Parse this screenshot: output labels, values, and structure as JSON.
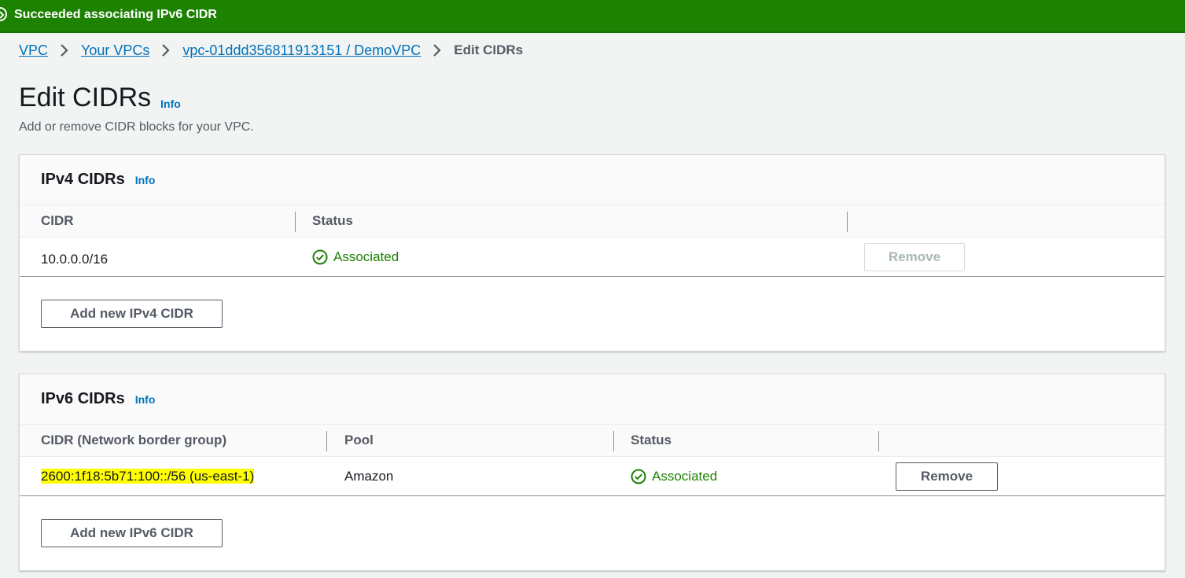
{
  "flash": {
    "message": "Succeeded associating IPv6 CIDR",
    "color": "#1d8102"
  },
  "breadcrumb": {
    "items": [
      "VPC",
      "Your VPCs",
      "vpc-01ddd356811913151 / DemoVPC"
    ],
    "current": "Edit CIDRs"
  },
  "page": {
    "title": "Edit CIDRs",
    "info_label": "Info",
    "description": "Add or remove CIDR blocks for your VPC."
  },
  "ipv4": {
    "title": "IPv4 CIDRs",
    "info_label": "Info",
    "columns": [
      "CIDR",
      "Status"
    ],
    "rows": [
      {
        "cidr": "10.0.0.0/16",
        "status": "Associated",
        "remove_label": "Remove",
        "remove_disabled": true
      }
    ],
    "add_label": "Add new IPv4 CIDR"
  },
  "ipv6": {
    "title": "IPv6 CIDRs",
    "info_label": "Info",
    "columns": [
      "CIDR (Network border group)",
      "Pool",
      "Status"
    ],
    "rows": [
      {
        "cidr": "2600:1f18:5b71:100::/56 (us-east-1)",
        "pool": "Amazon",
        "status": "Associated",
        "remove_label": "Remove",
        "remove_disabled": false
      }
    ],
    "add_label": "Add new IPv6 CIDR"
  },
  "colors": {
    "link": "#0073bb",
    "success": "#1d8102",
    "highlight": "#ffff00"
  },
  "icons": {
    "flash": "success-circle-icon",
    "separator": "chevron-right-icon",
    "status": "check-circle-icon"
  }
}
